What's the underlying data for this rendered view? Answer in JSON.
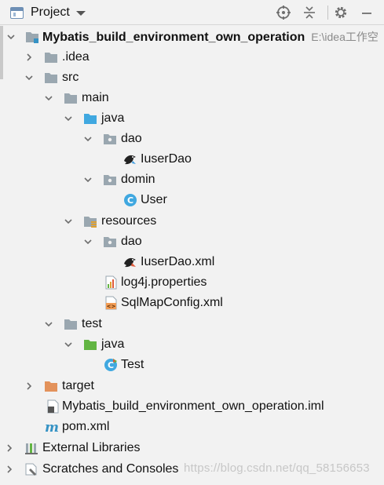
{
  "header": {
    "title": "Project",
    "colors": {
      "accent": "#3592c4",
      "folder": "#9aa7b0",
      "source_folder": "#40a8e0",
      "test_folder": "#62b543",
      "target_folder": "#e3925b"
    }
  },
  "tree": {
    "root": {
      "name": "Mybatis_build_environment_own_operation",
      "path": "E:\\idea工作空"
    },
    "idea": ".idea",
    "src": "src",
    "main": "main",
    "main_java": "java",
    "dao_pkg": "dao",
    "iuserdao": "IuserDao",
    "domin": "domin",
    "user": "User",
    "resources": "resources",
    "res_dao": "dao",
    "iuserdao_xml": "IuserDao.xml",
    "log4j": "log4j.properties",
    "sqlmap": "SqlMapConfig.xml",
    "test": "test",
    "test_java": "java",
    "test_class": "Test",
    "target": "target",
    "iml": "Mybatis_build_environment_own_operation.iml",
    "pom": "pom.xml",
    "external": "External Libraries",
    "scratches": "Scratches and Consoles"
  },
  "watermark": "https://blog.csdn.net/qq_58156653"
}
